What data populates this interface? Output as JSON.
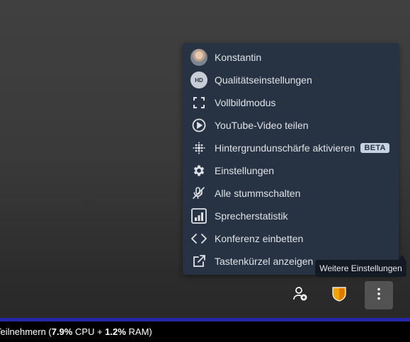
{
  "menu": {
    "items": [
      {
        "label": "Konstantin",
        "icon": "avatar"
      },
      {
        "label": "Qualitätseinstellungen",
        "icon": "hd-icon",
        "icon_text": "HD"
      },
      {
        "label": "Vollbildmodus",
        "icon": "fullscreen-icon"
      },
      {
        "label": "YouTube-Video teilen",
        "icon": "play-circle-icon"
      },
      {
        "label": "Hintergrundunschärfe aktivieren",
        "icon": "blur-icon",
        "badge": "BETA"
      },
      {
        "label": "Einstellungen",
        "icon": "gear-icon"
      },
      {
        "label": "Alle stummschalten",
        "icon": "mic-muted-icon"
      },
      {
        "label": "Sprecherstatistik",
        "icon": "bar-chart-icon"
      },
      {
        "label": "Konferenz einbetten",
        "icon": "code-icon"
      },
      {
        "label": "Tastenkürzel anzeigen",
        "icon": "open-external-icon"
      }
    ]
  },
  "tooltip": "Weitere Einstellungen",
  "toolbar": {
    "invite_icon": "add-participant-icon",
    "security_icon": "shield-icon",
    "more_icon": "more-vertical-icon"
  },
  "status": {
    "prefix": "Teilnehmern (",
    "cpu": "7.9%",
    "cpu_label": " CPU + ",
    "ram": "1.2%",
    "ram_label": " RAM)"
  },
  "colors": {
    "menu_bg": "#273343",
    "shield": "#f0a500",
    "status_bg": "#000000",
    "accent_line": "#2626a8"
  }
}
